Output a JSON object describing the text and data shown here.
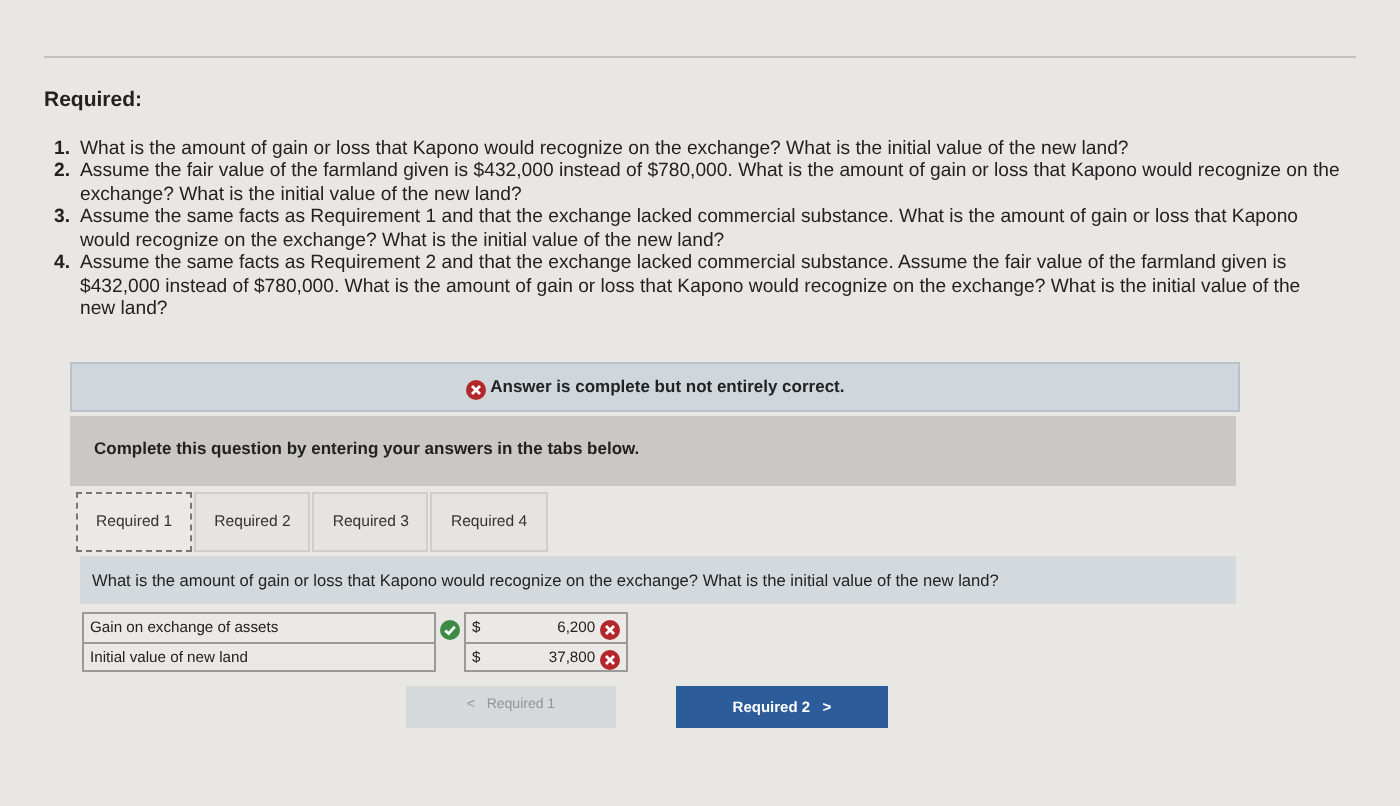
{
  "heading": "Required:",
  "requirements": [
    {
      "number": "1.",
      "text": "What is the amount of gain or loss that Kapono would recognize on the exchange? What is the initial value of the new land?"
    },
    {
      "number": "2.",
      "text": "Assume the fair value of the farmland given is $432,000 instead of $780,000. What is the amount of gain or loss that Kapono would recognize on the exchange? What is the initial value of the new land?"
    },
    {
      "number": "3.",
      "text": "Assume the same facts as Requirement 1 and that the exchange lacked commercial substance. What is the amount of gain or loss that Kapono would recognize on the exchange? What is the initial value of the new land?"
    },
    {
      "number": "4.",
      "text": "Assume the same facts as Requirement 2 and that the exchange lacked commercial substance. Assume the fair value of the farmland given is $432,000 instead of $780,000. What is the amount of gain or loss that Kapono would recognize on the exchange? What is the initial value of the new land?"
    }
  ],
  "status_banner": {
    "text": "Answer is complete but not entirely correct.",
    "correct": false
  },
  "instruction": "Complete this question by entering your answers in the tabs below.",
  "tabs": [
    {
      "label": "Required 1",
      "selected": true
    },
    {
      "label": "Required 2",
      "selected": false
    },
    {
      "label": "Required 3",
      "selected": false
    },
    {
      "label": "Required 4",
      "selected": false
    }
  ],
  "question": "What is the amount of gain or loss that Kapono would recognize on the exchange? What is the initial value of the new land?",
  "answer_rows": [
    {
      "label": "Gain on exchange of assets",
      "label_correct": true,
      "currency": "$",
      "value": "6,200",
      "value_correct": false
    },
    {
      "label": "Initial value of new land",
      "label_correct": false,
      "currency": "$",
      "value": "37,800",
      "value_correct": false
    }
  ],
  "prev_button": {
    "arrow": "<",
    "label": "Required 1",
    "disabled": true
  },
  "next_button": {
    "arrow": ">",
    "label": "Required 2",
    "disabled": false
  }
}
